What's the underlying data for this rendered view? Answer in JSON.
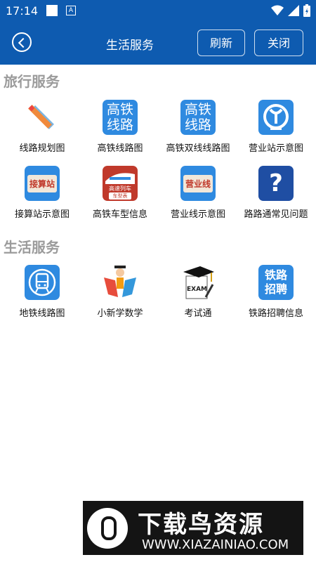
{
  "status": {
    "time": "17:14"
  },
  "header": {
    "title": "生活服务",
    "refresh_label": "刷新",
    "close_label": "关闭"
  },
  "sections": [
    {
      "title": "旅行服务",
      "items": [
        {
          "label": "线路规划图",
          "icon": "ruler-pencil-icon"
        },
        {
          "label": "高铁线路图",
          "icon": "highspeed-line-icon",
          "tile_text": [
            "高铁",
            "线路"
          ]
        },
        {
          "label": "高铁双线线路图",
          "icon": "highspeed-double-line-icon",
          "tile_text": [
            "高铁",
            "线路"
          ]
        },
        {
          "label": "营业站示意图",
          "icon": "railway-logo-icon"
        },
        {
          "label": "接算站示意图",
          "icon": "junction-station-icon",
          "tile_text": [
            "接算站"
          ]
        },
        {
          "label": "高铁车型信息",
          "icon": "train-model-icon",
          "tile_text": [
            "高速列车",
            "车型表"
          ]
        },
        {
          "label": "营业线示意图",
          "icon": "business-line-icon",
          "tile_text": [
            "营业线"
          ]
        },
        {
          "label": "路路通常见问题",
          "icon": "question-icon",
          "tile_text": [
            "?"
          ]
        }
      ]
    },
    {
      "title": "生活服务",
      "items": [
        {
          "label": "地铁线路图",
          "icon": "metro-icon"
        },
        {
          "label": "小新学数学",
          "icon": "student-math-icon"
        },
        {
          "label": "考试通",
          "icon": "exam-cap-icon",
          "tile_text": [
            "EXAM"
          ]
        },
        {
          "label": "铁路招聘信息",
          "icon": "railway-recruit-icon",
          "tile_text": [
            "铁路",
            "招聘"
          ]
        }
      ]
    }
  ],
  "watermark": {
    "title": "下载鸟资源",
    "url": "WWW.XIAZAINIAO.COM"
  }
}
